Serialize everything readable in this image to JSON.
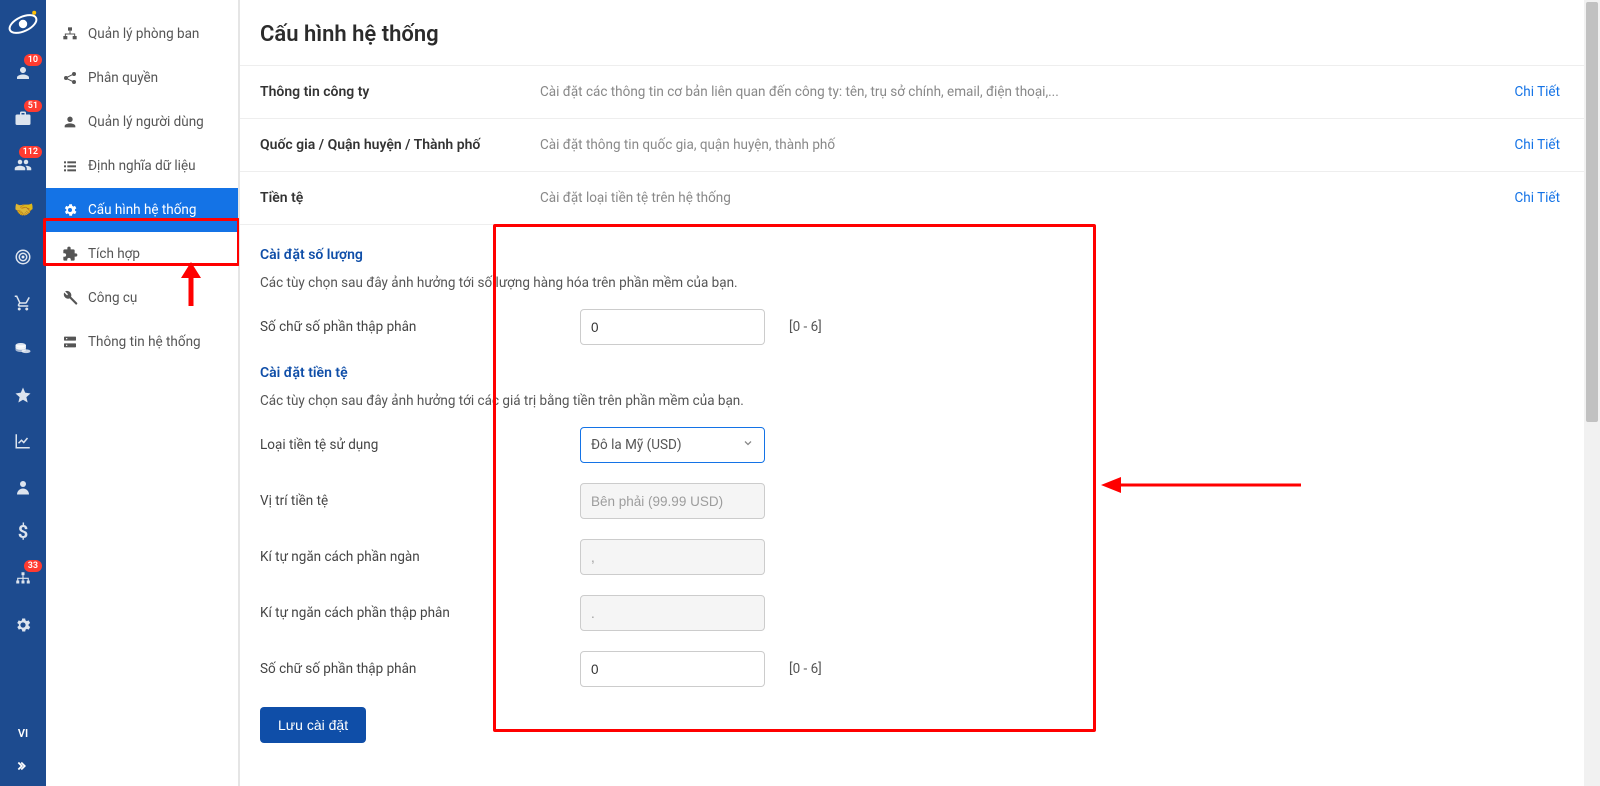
{
  "rail": {
    "badges": {
      "users": "10",
      "briefcase": "51",
      "group": "112",
      "org": "33"
    },
    "lang": "VI"
  },
  "sidebar": {
    "items": [
      {
        "label": "Quản lý phòng ban"
      },
      {
        "label": "Phân quyền"
      },
      {
        "label": "Quản lý người dùng"
      },
      {
        "label": "Định nghĩa dữ liệu"
      },
      {
        "label": "Cấu hình hệ thống"
      },
      {
        "label": "Tích hợp"
      },
      {
        "label": "Công cụ"
      },
      {
        "label": "Thông tin hệ thống"
      }
    ]
  },
  "page": {
    "title": "Cấu hình hệ thống",
    "rows": [
      {
        "label": "Thông tin công ty",
        "desc": "Cài đặt các thông tin cơ bản liên quan đến công ty: tên, trụ sở chính, email, điện thoại,...",
        "link": "Chi Tiết"
      },
      {
        "label": "Quốc gia / Quận huyện / Thành phố",
        "desc": "Cài đặt thông tin quốc gia, quận huyện, thành phố",
        "link": "Chi Tiết"
      },
      {
        "label": "Tiền tệ",
        "desc": "Cài đặt loại tiền tệ trên hệ thống",
        "link": "Chi Tiết"
      }
    ],
    "qty": {
      "heading": "Cài đặt số lượng",
      "hint": "Các tùy chọn sau đây ảnh hưởng tới số lượng hàng hóa trên phần mềm của bạn.",
      "decimal_label": "Số chữ số phần thập phân",
      "decimal_value": "0",
      "decimal_range": "[0 - 6]"
    },
    "currency": {
      "heading": "Cài đặt tiền tệ",
      "hint": "Các tùy chọn sau đây ảnh hưởng tới các giá trị bằng tiền trên phần mềm của bạn.",
      "type_label": "Loại tiền tệ sử dụng",
      "type_value": "Đô la Mỹ (USD)",
      "pos_label": "Vị trí tiền tệ",
      "pos_value": "Bên phải (99.99 USD)",
      "thou_label": "Kí tự ngăn cách phần ngàn",
      "thou_value": ",",
      "dec_label": "Kí tự ngăn cách phần thập phân",
      "dec_value": ".",
      "digits_label": "Số chữ số phần thập phân",
      "digits_value": "0",
      "digits_range": "[0 - 6]"
    },
    "save_label": "Lưu cài đặt"
  }
}
